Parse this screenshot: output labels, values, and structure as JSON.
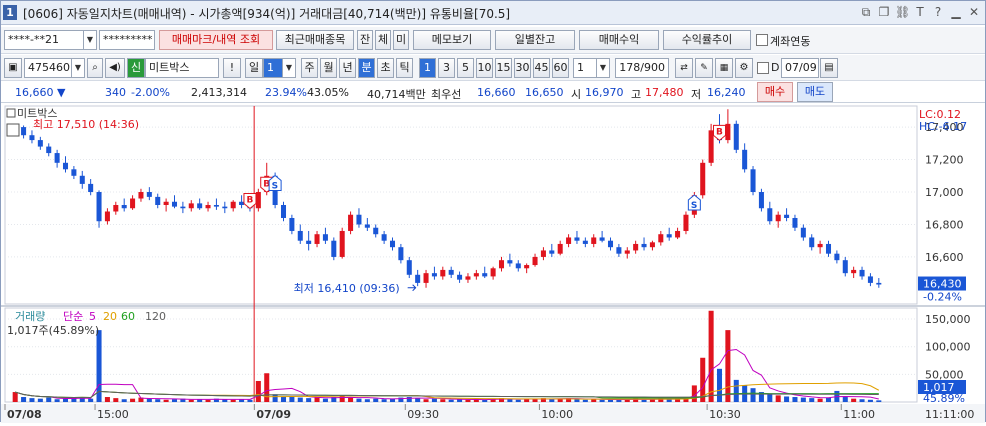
{
  "window": {
    "badge": "1",
    "title": "[0606] 자동일지차트(매매내역) - 시가총액[934(억)] 거래대금[40,714(백만)] 유통비율[70.5]",
    "title_icons": [
      "restore-icon",
      "copy-icon",
      "link-icon",
      "text-icon",
      "help-icon",
      "minimize-icon",
      "close-icon"
    ]
  },
  "toolbar1": {
    "account": "****-**21",
    "password": "*********",
    "trade_mark_btn": "매매마크/내역 조회",
    "recent_trade_btn": "최근매매종목",
    "btn_jan": "잔",
    "btn_che": "체",
    "btn_mi": "미",
    "memo_btn": "메모보기",
    "daily_balance_btn": "일별잔고",
    "trade_profit_btn": "매매수익",
    "profit_trend_btn": "수익률추이",
    "account_link_label": "계좌연동"
  },
  "toolbar2": {
    "code": "475460",
    "shin": "신",
    "stock_name": "미트박스",
    "period_label": "일",
    "period_value": "1",
    "periods": [
      "주",
      "월",
      "년",
      "분",
      "초",
      "틱"
    ],
    "selected_period": "분",
    "intervals": [
      "1",
      "3",
      "5",
      "10",
      "15",
      "30",
      "45",
      "60"
    ],
    "selected_interval": "1",
    "custom_interval": "1",
    "count": "178/900",
    "d_label": "D",
    "date": "07/09"
  },
  "quote": {
    "price": "16,660",
    "change": "340",
    "change_pct": "-2.00%",
    "volume": "2,413,314",
    "turnover": "23.94%",
    "ratio": "43.05%",
    "amount": "40,714백만",
    "best_bid_label": "최우선",
    "ask": "16,660",
    "bid": "16,650",
    "open_label": "시",
    "open": "16,970",
    "high_label": "고",
    "high": "17,480",
    "low_label": "저",
    "low": "16,240",
    "buy_btn": "매수",
    "sell_btn": "매도"
  },
  "chart_data": {
    "type": "candlestick",
    "stock_label": "미트박스",
    "high_annotation": "최고 17,510 (14:36)",
    "low_annotation": "최저 16,410 (09:36)",
    "lc": "LC:0.12",
    "hc": "HC:-6.17",
    "price_axis": [
      "17,400",
      "17,200",
      "17,000",
      "16,800",
      "16,600"
    ],
    "price_ylim": [
      16310,
      17530
    ],
    "last_price": "16,430",
    "last_change_pct": "-0.24%",
    "volume_legend": {
      "label": "거래량",
      "ma_label": "단순",
      "ma": [
        "5",
        "20",
        "60",
        "120"
      ],
      "colors": [
        "#c000c0",
        "#e0a000",
        "#20a020",
        "#606060"
      ]
    },
    "volume_info": "1,017주(45.89%)",
    "volume_axis": [
      "150,000",
      "100,000",
      "50,000"
    ],
    "volume_ylim": [
      0,
      170000
    ],
    "last_volume": "1,017",
    "last_volume_pct": "45.89%",
    "x_labels": [
      "07/08",
      "15:00",
      "07/09",
      "09:30",
      "10:00",
      "10:30",
      "11:00"
    ],
    "time_now": "11:11:00",
    "candles": [
      [
        17380,
        17420,
        17360,
        17400
      ],
      [
        17400,
        17410,
        17330,
        17350
      ],
      [
        17350,
        17380,
        17300,
        17320
      ],
      [
        17320,
        17340,
        17260,
        17280
      ],
      [
        17280,
        17300,
        17220,
        17240
      ],
      [
        17240,
        17260,
        17150,
        17180
      ],
      [
        17180,
        17220,
        17120,
        17140
      ],
      [
        17140,
        17160,
        17080,
        17100
      ],
      [
        17100,
        17130,
        17020,
        17050
      ],
      [
        17050,
        17080,
        16980,
        17000
      ],
      [
        17000,
        17010,
        16780,
        16820
      ],
      [
        16820,
        16900,
        16800,
        16880
      ],
      [
        16880,
        16940,
        16860,
        16920
      ],
      [
        16920,
        16960,
        16880,
        16900
      ],
      [
        16900,
        16980,
        16890,
        16960
      ],
      [
        16960,
        17020,
        16940,
        17000
      ],
      [
        17000,
        17030,
        16950,
        16970
      ],
      [
        16970,
        16990,
        16900,
        16920
      ],
      [
        16920,
        16960,
        16880,
        16940
      ],
      [
        16940,
        16980,
        16900,
        16910
      ],
      [
        16910,
        16940,
        16870,
        16900
      ],
      [
        16900,
        16950,
        16880,
        16930
      ],
      [
        16930,
        16960,
        16890,
        16900
      ],
      [
        16900,
        16940,
        16880,
        16920
      ],
      [
        16920,
        16960,
        16890,
        16910
      ],
      [
        16910,
        16940,
        16870,
        16900
      ],
      [
        16900,
        16950,
        16880,
        16940
      ],
      [
        16940,
        16980,
        16900,
        16920
      ],
      [
        16920,
        16960,
        16880,
        16900
      ],
      [
        16900,
        17020,
        16880,
        17000
      ],
      [
        17000,
        17180,
        16980,
        17100
      ],
      [
        17100,
        17120,
        16900,
        16920
      ],
      [
        16920,
        16940,
        16820,
        16840
      ],
      [
        16840,
        16860,
        16740,
        16760
      ],
      [
        16760,
        16800,
        16680,
        16700
      ],
      [
        16700,
        16760,
        16640,
        16680
      ],
      [
        16680,
        16760,
        16660,
        16740
      ],
      [
        16740,
        16780,
        16680,
        16700
      ],
      [
        16700,
        16720,
        16580,
        16600
      ],
      [
        16600,
        16780,
        16590,
        16760
      ],
      [
        16760,
        16880,
        16740,
        16860
      ],
      [
        16860,
        16900,
        16780,
        16800
      ],
      [
        16800,
        16840,
        16760,
        16780
      ],
      [
        16780,
        16800,
        16720,
        16740
      ],
      [
        16740,
        16760,
        16680,
        16700
      ],
      [
        16700,
        16720,
        16640,
        16660
      ],
      [
        16660,
        16680,
        16560,
        16580
      ],
      [
        16580,
        16600,
        16470,
        16490
      ],
      [
        16490,
        16520,
        16420,
        16440
      ],
      [
        16440,
        16520,
        16410,
        16500
      ],
      [
        16500,
        16540,
        16460,
        16480
      ],
      [
        16480,
        16540,
        16460,
        16520
      ],
      [
        16520,
        16540,
        16470,
        16490
      ],
      [
        16490,
        16510,
        16440,
        16460
      ],
      [
        16460,
        16500,
        16440,
        16480
      ],
      [
        16480,
        16520,
        16460,
        16500
      ],
      [
        16500,
        16540,
        16470,
        16480
      ],
      [
        16480,
        16540,
        16460,
        16530
      ],
      [
        16530,
        16600,
        16510,
        16580
      ],
      [
        16580,
        16620,
        16540,
        16560
      ],
      [
        16560,
        16580,
        16510,
        16530
      ],
      [
        16530,
        16560,
        16500,
        16550
      ],
      [
        16550,
        16620,
        16540,
        16600
      ],
      [
        16600,
        16660,
        16580,
        16640
      ],
      [
        16640,
        16680,
        16600,
        16620
      ],
      [
        16620,
        16700,
        16610,
        16680
      ],
      [
        16680,
        16740,
        16660,
        16720
      ],
      [
        16720,
        16760,
        16680,
        16700
      ],
      [
        16700,
        16720,
        16660,
        16680
      ],
      [
        16680,
        16740,
        16660,
        16720
      ],
      [
        16720,
        16760,
        16690,
        16700
      ],
      [
        16700,
        16720,
        16640,
        16660
      ],
      [
        16660,
        16680,
        16600,
        16620
      ],
      [
        16620,
        16660,
        16590,
        16640
      ],
      [
        16640,
        16700,
        16620,
        16680
      ],
      [
        16680,
        16720,
        16640,
        16660
      ],
      [
        16660,
        16700,
        16640,
        16690
      ],
      [
        16690,
        16760,
        16670,
        16740
      ],
      [
        16740,
        16780,
        16700,
        16720
      ],
      [
        16720,
        16780,
        16710,
        16760
      ],
      [
        16760,
        16880,
        16740,
        16860
      ],
      [
        16860,
        17000,
        16840,
        16980
      ],
      [
        16980,
        17200,
        16960,
        17180
      ],
      [
        17180,
        17420,
        17160,
        17380
      ],
      [
        17380,
        17480,
        17300,
        17320
      ],
      [
        17320,
        17510,
        17300,
        17420
      ],
      [
        17420,
        17440,
        17240,
        17260
      ],
      [
        17260,
        17300,
        17120,
        17140
      ],
      [
        17140,
        17160,
        16980,
        17000
      ],
      [
        17000,
        17020,
        16880,
        16900
      ],
      [
        16900,
        16940,
        16800,
        16820
      ],
      [
        16820,
        16880,
        16780,
        16860
      ],
      [
        16860,
        16900,
        16820,
        16840
      ],
      [
        16840,
        16860,
        16760,
        16780
      ],
      [
        16780,
        16800,
        16700,
        16720
      ],
      [
        16720,
        16740,
        16640,
        16660
      ],
      [
        16660,
        16700,
        16620,
        16680
      ],
      [
        16680,
        16700,
        16600,
        16620
      ],
      [
        16620,
        16640,
        16560,
        16580
      ],
      [
        16580,
        16600,
        16480,
        16500
      ],
      [
        16500,
        16540,
        16470,
        16520
      ],
      [
        16520,
        16540,
        16460,
        16480
      ],
      [
        16480,
        16500,
        16420,
        16440
      ],
      [
        16440,
        16470,
        16410,
        16430
      ]
    ],
    "volumes": [
      18000,
      9000,
      7000,
      6000,
      8000,
      5000,
      6000,
      7000,
      9000,
      6000,
      130000,
      9000,
      7000,
      5000,
      6000,
      8000,
      6000,
      5000,
      4000,
      5000,
      6000,
      4000,
      5000,
      4000,
      6000,
      5000,
      4000,
      5000,
      4000,
      38000,
      52000,
      14000,
      10000,
      9000,
      8000,
      7000,
      8000,
      6000,
      9000,
      11000,
      8000,
      6000,
      5000,
      6000,
      5000,
      6000,
      8000,
      9000,
      7000,
      5000,
      6000,
      5000,
      4000,
      5000,
      4000,
      5000,
      4000,
      6000,
      7000,
      5000,
      4000,
      5000,
      6000,
      7000,
      5000,
      6000,
      7000,
      5000,
      4000,
      5000,
      4000,
      5000,
      4000,
      5000,
      6000,
      4000,
      5000,
      6000,
      5000,
      6000,
      9000,
      30000,
      80000,
      165000,
      60000,
      130000,
      40000,
      30000,
      25000,
      18000,
      15000,
      12000,
      10000,
      9000,
      8000,
      7000,
      6000,
      8000,
      20000,
      9000,
      6000,
      5000,
      4000,
      3000
    ],
    "buy_markers": [
      28,
      30,
      84
    ],
    "sell_markers": [
      31,
      81
    ],
    "session_split_index": 29
  }
}
